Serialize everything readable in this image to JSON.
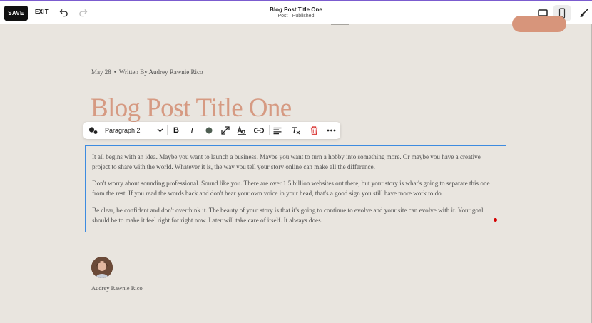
{
  "topbar": {
    "save_label": "SAVE",
    "exit_label": "EXIT",
    "title": "Blog Post Title One",
    "subtitle": "Post · Published",
    "icons": [
      "undo-icon",
      "redo-icon",
      "desktop-icon",
      "mobile-icon",
      "brush-icon"
    ],
    "accent_color": "#7b5ccf"
  },
  "post": {
    "date": "May 28",
    "separator": "•",
    "byline": "Written By Audrey Rawnie Rico",
    "title": "Blog Post Title One",
    "title_color": "#d69a82",
    "paragraphs": [
      "It all begins with an idea. Maybe you want to launch a business. Maybe you want to turn a hobby into something more. Or maybe you have a creative project to share with the world. Whatever it is, the way you tell your story online can make all the difference.",
      "Don't worry about sounding professional. Sound like you. There are over 1.5 billion websites out there, but your story is what's going to separate this one from the rest. If you read the words back and don't hear your own voice in your head, that's a good sign you still have more work to do.",
      "Be clear, be confident and don't overthink it. The beauty of your story is that it's going to continue to evolve and your site can evolve with it. Your goal should be to make it feel right for right now. Later will take care of itself. It always does."
    ],
    "author_name": "Audrey Rawnie Rico"
  },
  "toolbar": {
    "paragraph_style": "Paragraph 2",
    "bold_label": "B",
    "italic_label": "I",
    "icons": [
      "block-style-icon",
      "chevron-down-icon",
      "text-color-icon",
      "text-size-icon",
      "font-style-icon",
      "link-icon",
      "align-left-icon",
      "clear-format-icon",
      "delete-icon",
      "more-icon"
    ],
    "delete_color": "#d9302f"
  },
  "selection_color": "#3d8be0"
}
